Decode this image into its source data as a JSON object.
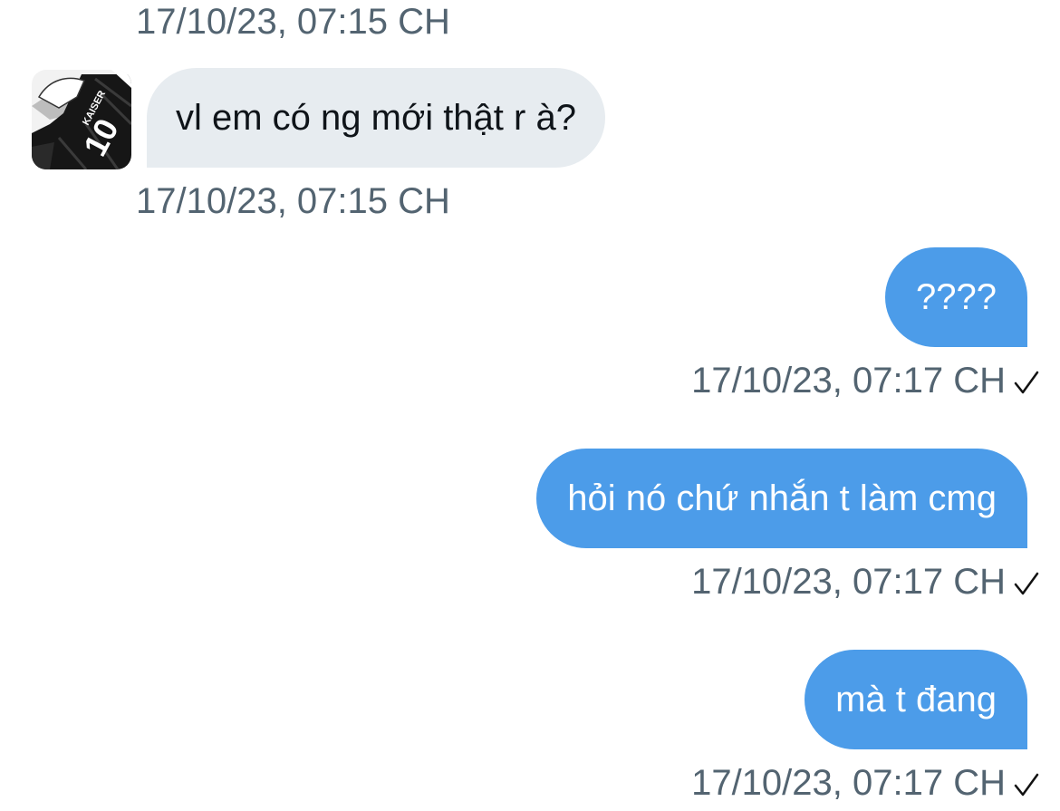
{
  "conversation": {
    "header_timestamp": "17/10/23, 07:15 CH",
    "messages": [
      {
        "direction": "incoming",
        "text": "vl em có ng mới thật r à?",
        "timestamp": "17/10/23, 07:15 CH",
        "avatar_icon": "user-avatar-manga-kaiser-10"
      },
      {
        "direction": "outgoing",
        "text": "????",
        "timestamp": "17/10/23, 07:17 CH",
        "status_icon": "checkmark-sent-icon"
      },
      {
        "direction": "outgoing",
        "text": "hỏi nó chứ nhắn t làm cmg",
        "timestamp": "17/10/23, 07:17 CH",
        "status_icon": "checkmark-sent-icon"
      },
      {
        "direction": "outgoing",
        "text": "mà t đang",
        "timestamp": "17/10/23, 07:17 CH",
        "status_icon": "checkmark-sent-icon"
      }
    ],
    "avatar_jersey_name": "KAISER",
    "avatar_jersey_number": "10"
  },
  "colors": {
    "incoming_bubble": "#e7ecf0",
    "outgoing_bubble": "#4c9ce9",
    "timestamp_text": "#536471"
  }
}
